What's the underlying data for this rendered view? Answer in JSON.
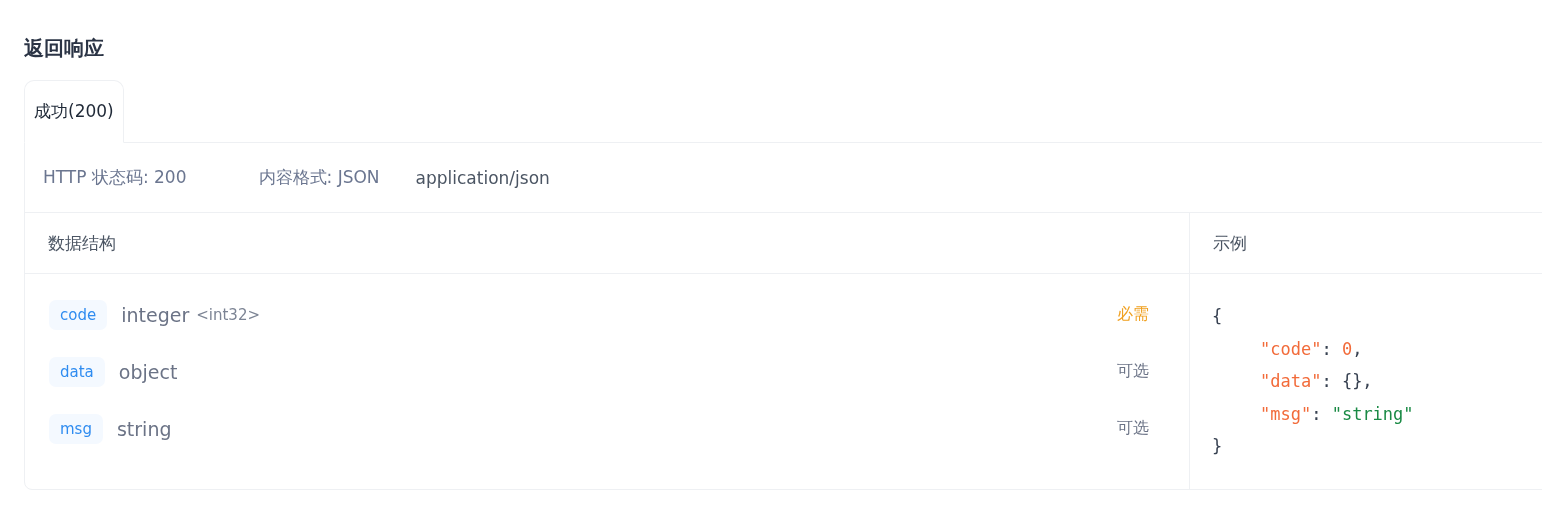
{
  "section_title": "返回响应",
  "tabs": [
    {
      "label": "成功(200)",
      "selected": true
    }
  ],
  "info": {
    "status": "HTTP 状态码: 200",
    "format": "内容格式: JSON",
    "content_type": "application/json"
  },
  "schema": {
    "heading": "数据结构",
    "fields": [
      {
        "name": "code",
        "type": "integer",
        "format": "<int32>",
        "requirement": "必需",
        "required": true
      },
      {
        "name": "data",
        "type": "object",
        "requirement": "可选",
        "required": false
      },
      {
        "name": "msg",
        "type": "string",
        "requirement": "可选",
        "required": false
      }
    ]
  },
  "example": {
    "heading": "示例",
    "lines": [
      [
        {
          "kind": "punct",
          "text": "{"
        }
      ],
      [
        {
          "kind": "key",
          "text": "\"code\""
        },
        {
          "kind": "punct",
          "text": ": "
        },
        {
          "kind": "number",
          "text": "0"
        },
        {
          "kind": "punct",
          "text": ","
        }
      ],
      [
        {
          "kind": "key",
          "text": "\"data\""
        },
        {
          "kind": "punct",
          "text": ": {},"
        }
      ],
      [
        {
          "kind": "key",
          "text": "\"msg\""
        },
        {
          "kind": "punct",
          "text": ": "
        },
        {
          "kind": "string",
          "text": "\"string\""
        }
      ],
      [
        {
          "kind": "punct",
          "text": "}"
        }
      ]
    ]
  }
}
